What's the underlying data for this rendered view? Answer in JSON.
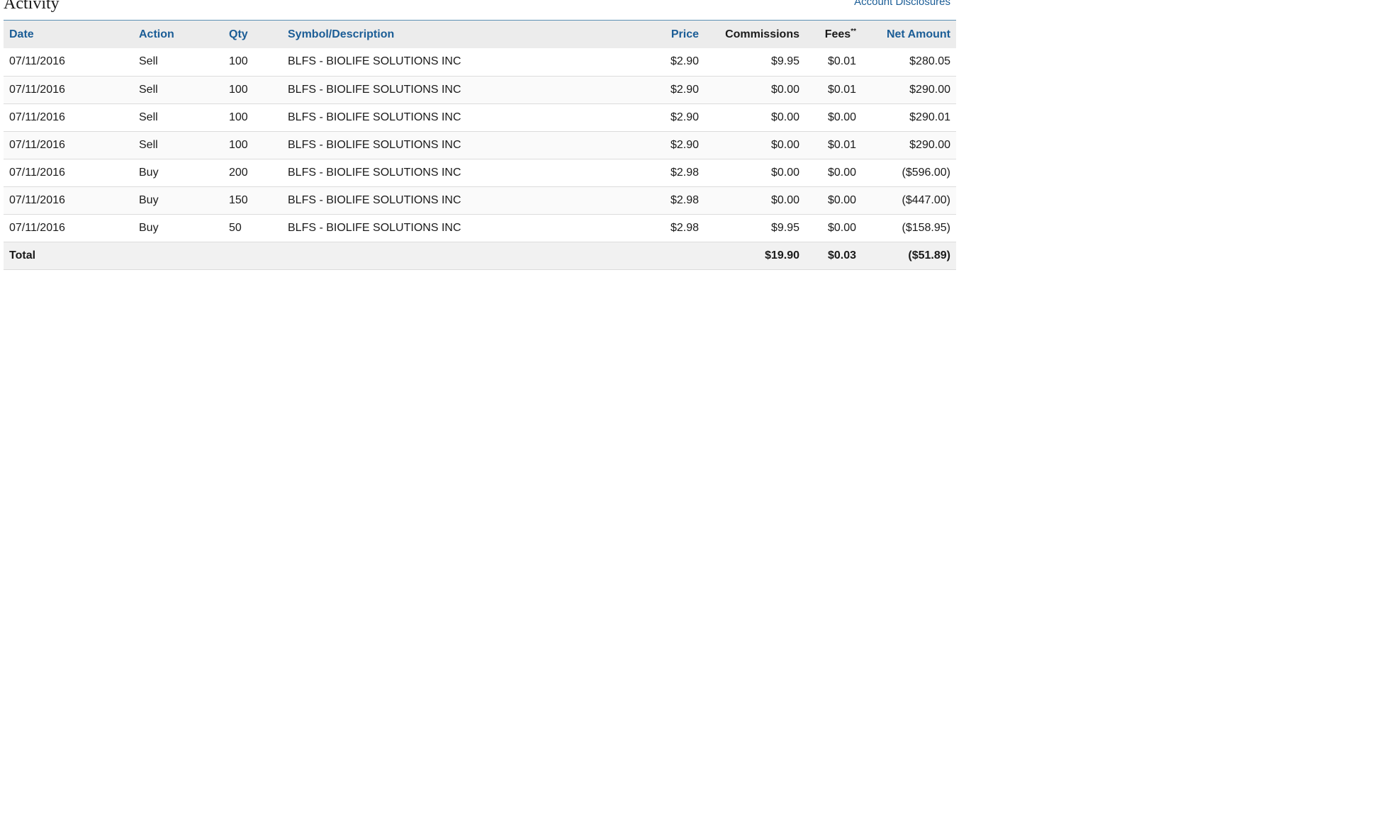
{
  "section": {
    "title": "Activity",
    "disclosures_link": "Account Disclosures"
  },
  "table": {
    "columns": {
      "date": "Date",
      "action": "Action",
      "qty": "Qty",
      "symbol": "Symbol/Description",
      "price": "Price",
      "commissions": "Commissions",
      "fees": "Fees",
      "fees_mark": "**",
      "net_amount": "Net Amount"
    },
    "rows": [
      {
        "date": "07/11/2016",
        "action": "Sell",
        "qty": "100",
        "symbol": "BLFS - BIOLIFE SOLUTIONS INC",
        "price": "$2.90",
        "commissions": "$9.95",
        "fees": "$0.01",
        "net_amount": "$280.05"
      },
      {
        "date": "07/11/2016",
        "action": "Sell",
        "qty": "100",
        "symbol": "BLFS - BIOLIFE SOLUTIONS INC",
        "price": "$2.90",
        "commissions": "$0.00",
        "fees": "$0.01",
        "net_amount": "$290.00"
      },
      {
        "date": "07/11/2016",
        "action": "Sell",
        "qty": "100",
        "symbol": "BLFS - BIOLIFE SOLUTIONS INC",
        "price": "$2.90",
        "commissions": "$0.00",
        "fees": "$0.00",
        "net_amount": "$290.01"
      },
      {
        "date": "07/11/2016",
        "action": "Sell",
        "qty": "100",
        "symbol": "BLFS - BIOLIFE SOLUTIONS INC",
        "price": "$2.90",
        "commissions": "$0.00",
        "fees": "$0.01",
        "net_amount": "$290.00"
      },
      {
        "date": "07/11/2016",
        "action": "Buy",
        "qty": "200",
        "symbol": "BLFS - BIOLIFE SOLUTIONS INC",
        "price": "$2.98",
        "commissions": "$0.00",
        "fees": "$0.00",
        "net_amount": "($596.00)"
      },
      {
        "date": "07/11/2016",
        "action": "Buy",
        "qty": "150",
        "symbol": "BLFS - BIOLIFE SOLUTIONS INC",
        "price": "$2.98",
        "commissions": "$0.00",
        "fees": "$0.00",
        "net_amount": "($447.00)"
      },
      {
        "date": "07/11/2016",
        "action": "Buy",
        "qty": "50",
        "symbol": "BLFS - BIOLIFE SOLUTIONS INC",
        "price": "$2.98",
        "commissions": "$9.95",
        "fees": "$0.00",
        "net_amount": "($158.95)"
      }
    ],
    "total": {
      "label": "Total",
      "commissions": "$19.90",
      "fees": "$0.03",
      "net_amount": "($51.89)"
    }
  },
  "colors": {
    "link": "#1b5d96",
    "header_bg": "#ececec",
    "rule": "#5b8fb3"
  }
}
